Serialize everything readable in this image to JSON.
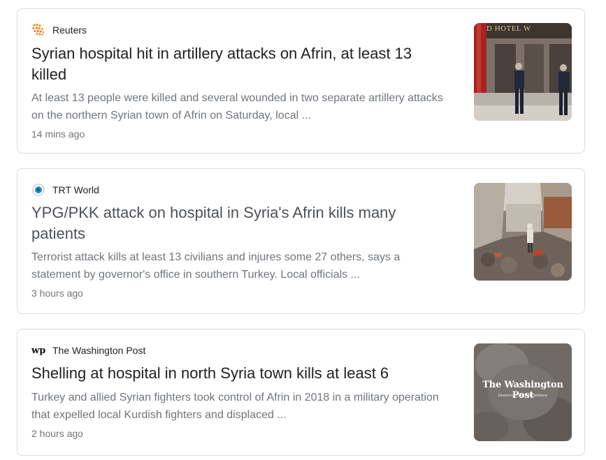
{
  "articles": [
    {
      "source": "Reuters",
      "source_icon": "reuters-dots-icon",
      "headline": "Syrian hospital hit in artillery attacks on Afrin, at least 13 killed",
      "snippet": "At least 13 people were killed and several wounded in two separate artillery attacks on the northern Syrian town of Afrin on Saturday, local ...",
      "age": "14 mins ago",
      "thumbnail": {
        "icon": "hotel-entrance-photo",
        "sign_text": "D HOTEL W"
      }
    },
    {
      "source": "TRT World",
      "source_icon": "trt-world-circle-icon",
      "headline": "YPG/PKK attack on hospital in Syria's Afrin kills many patients",
      "snippet": "Terrorist attack kills at least 13 civilians and injures some 27 others, says a statement by governor's office in southern Turkey. Local officials ...",
      "age": "3 hours ago",
      "thumbnail": {
        "icon": "rubble-street-photo"
      }
    },
    {
      "source": "The Washington Post",
      "source_icon": "wp-monogram-icon",
      "headline": "Shelling at hospital in north Syria town kills at least 6",
      "snippet": "Turkey and allied Syrian fighters took control of Afrin in 2018 in a military operation that expelled local Kurdish fighters and displaced ...",
      "age": "2 hours ago",
      "thumbnail": {
        "icon": "washington-post-placeholder",
        "masthead": "The Washington Post",
        "tagline": "Democracy Dies in Darkness"
      }
    }
  ],
  "colors": {
    "headline": "#202124",
    "headline_muted": "#4d5156",
    "snippet": "#70757a",
    "border": "#dadce0",
    "reuters_orange": "#f28c28",
    "trt_blue": "#1a8fc9"
  }
}
